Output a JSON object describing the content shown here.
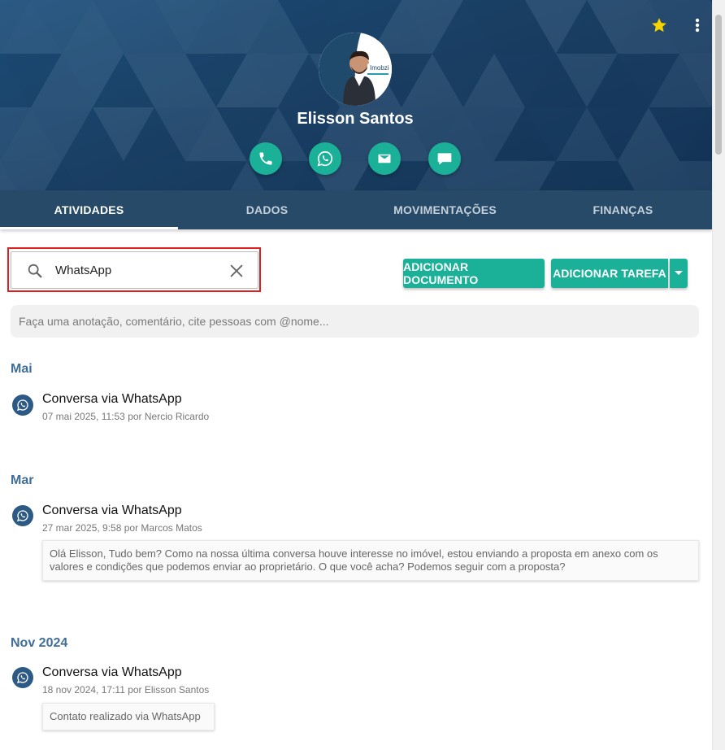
{
  "profile": {
    "name": "Elisson Santos",
    "avatar_brand_text": "Imobzi"
  },
  "header": {
    "favorite_icon": "star-icon",
    "menu_icon": "more-vert-icon",
    "actions": [
      {
        "name": "phone",
        "icon": "phone-icon"
      },
      {
        "name": "whatsapp",
        "icon": "whatsapp-icon"
      },
      {
        "name": "email",
        "icon": "mail-icon"
      },
      {
        "name": "message",
        "icon": "chat-icon"
      }
    ]
  },
  "tabs": [
    {
      "label": "ATIVIDADES",
      "active": true
    },
    {
      "label": "DADOS",
      "active": false
    },
    {
      "label": "MOVIMENTAÇÕES",
      "active": false
    },
    {
      "label": "FINANÇAS",
      "active": false
    }
  ],
  "search": {
    "value": "WhatsApp",
    "placeholder": ""
  },
  "buttons": {
    "add_document": "ADICIONAR DOCUMENTO",
    "add_task": "ADICIONAR TAREFA"
  },
  "note": {
    "placeholder": "Faça uma anotação, comentário, cite pessoas com @nome..."
  },
  "timeline": [
    {
      "month": "Mai",
      "items": [
        {
          "title": "Conversa via WhatsApp",
          "meta": "07 mai 2025, 11:53 por Nercio Ricardo",
          "note": ""
        }
      ]
    },
    {
      "month": "Mar",
      "items": [
        {
          "title": "Conversa via WhatsApp",
          "meta": "27 mar 2025, 9:58 por Marcos Matos",
          "note": "Olá Elisson, Tudo bem? Como na nossa última conversa houve interesse no imóvel, estou enviando a proposta em anexo com os valores e condições que podemos enviar ao proprietário. O que você acha? Podemos seguir com a proposta?"
        }
      ]
    },
    {
      "month": "Nov 2024",
      "items": [
        {
          "title": "Conversa via WhatsApp",
          "meta": "18 nov 2024, 17:11 por Elisson Santos",
          "note": "Contato realizado via WhatsApp"
        }
      ]
    }
  ],
  "colors": {
    "accent": "#1bb198",
    "header_bg": "#1b4268",
    "tabs_bg": "#264a68",
    "month_label": "#3f6e98",
    "highlight": "#e01f1f",
    "star": "#f5d400"
  }
}
